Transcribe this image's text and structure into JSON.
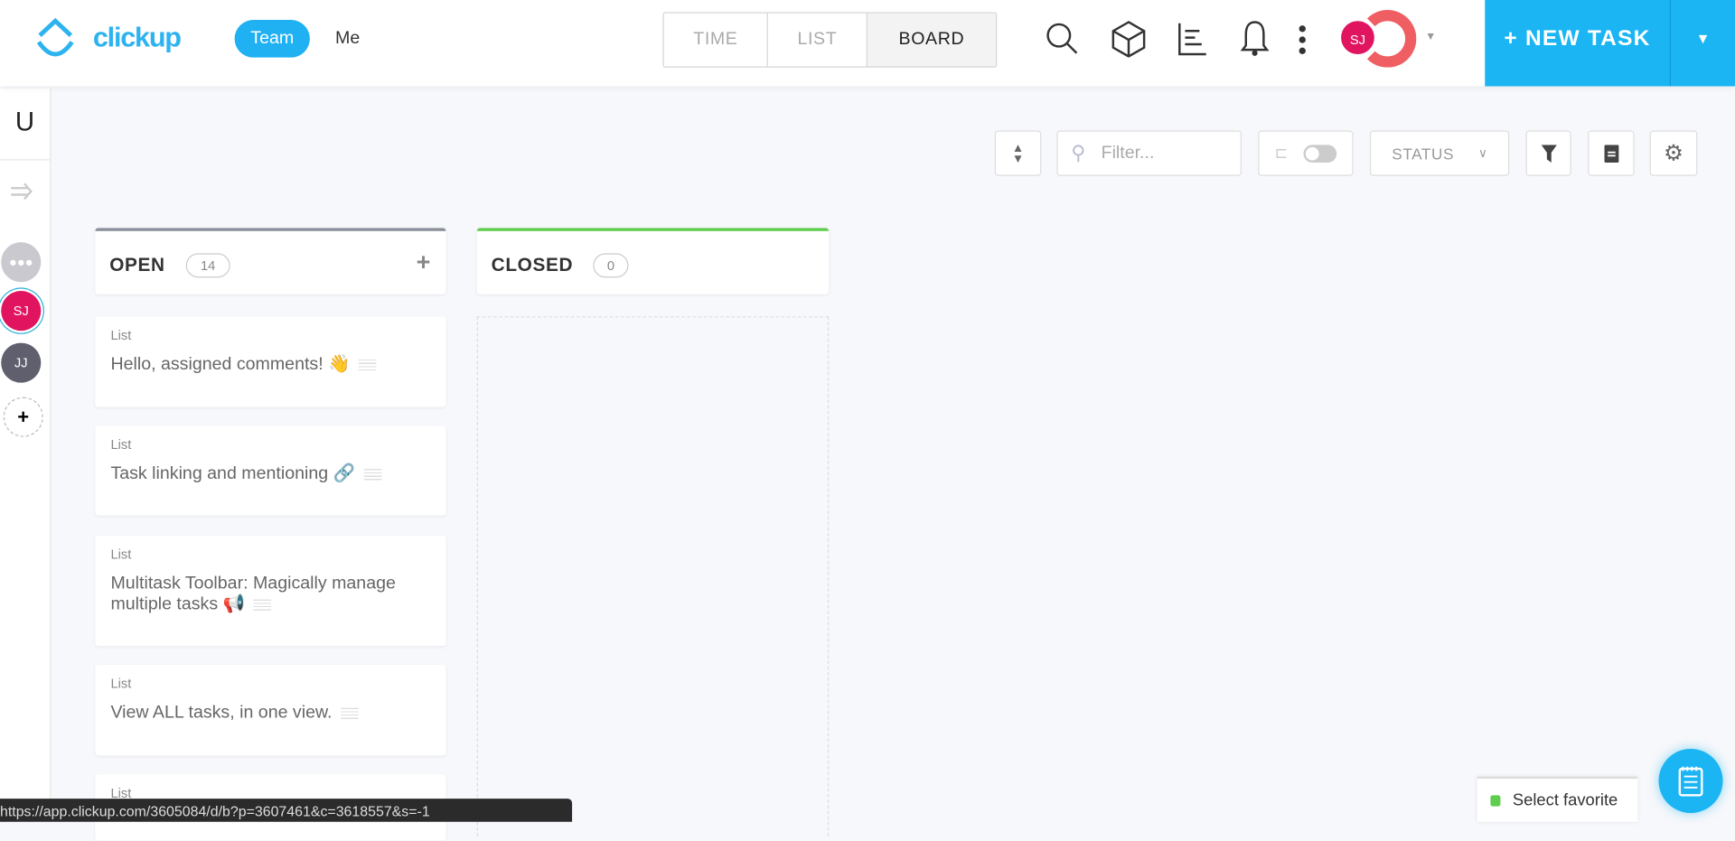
{
  "header": {
    "logo": "clickup",
    "scope_tabs": [
      {
        "label": "Team",
        "active": true
      },
      {
        "label": "Me",
        "active": false
      }
    ],
    "view_tabs": [
      {
        "label": "TIME"
      },
      {
        "label": "LIST"
      },
      {
        "label": "BOARD",
        "active": true
      }
    ],
    "avatar": "SJ",
    "new_task_label": "+ NEW TASK",
    "accent": "#1bb5f4"
  },
  "sidebar": {
    "space_initial": "U",
    "members": [
      {
        "initials": "SJ",
        "color": "#e0145f"
      },
      {
        "initials": "JJ",
        "color": "#5f5f6e"
      }
    ]
  },
  "toolbar": {
    "filter_placeholder": "Filter...",
    "status_label": "STATUS"
  },
  "columns": [
    {
      "title": "OPEN",
      "count": "14",
      "color": "#8a8f99",
      "cards": [
        {
          "list": "List",
          "name": "Hello, assigned comments! 👋"
        },
        {
          "list": "List",
          "name": "Task linking and mentioning 🔗"
        },
        {
          "list": "List",
          "name": "Multitask Toolbar: Magically manage multiple tasks 📢"
        },
        {
          "list": "List",
          "name": "View ALL tasks, in one view."
        },
        {
          "list": "List",
          "name": ""
        }
      ]
    },
    {
      "title": "CLOSED",
      "count": "0",
      "color": "#5fce4e",
      "cards": []
    }
  ],
  "status_bar_url": "https://app.clickup.com/3605084/d/b?p=3607461&c=3618557&s=-1",
  "favorites_label": "Select favorite"
}
